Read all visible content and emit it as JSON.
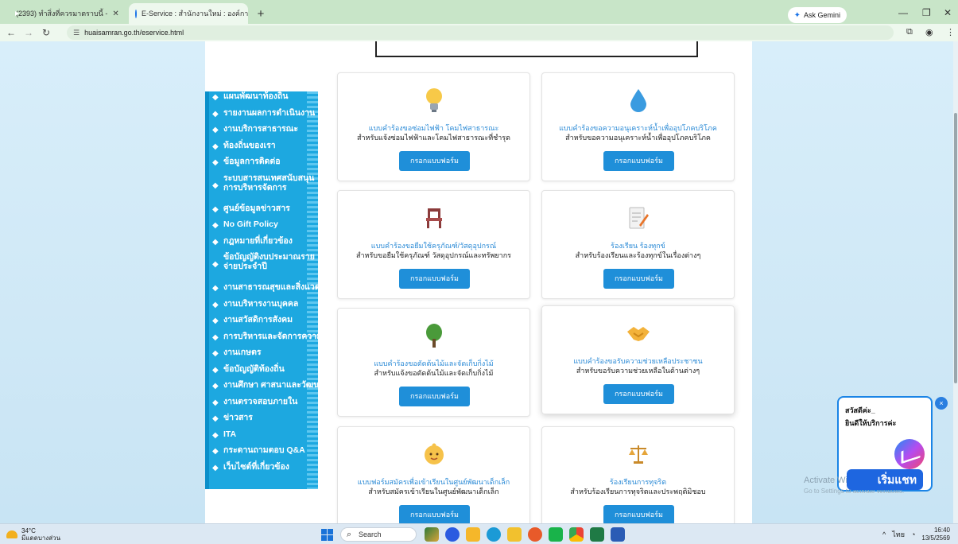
{
  "browser": {
    "tabs": [
      {
        "title": "(2393) ทำสิ่งที่ควรมาตราบนี้ - ",
        "icon": "youtube-icon",
        "active": false
      },
      {
        "title": "E-Service : สำนักงานใหม่ : องค์การ",
        "icon": "globe-icon",
        "active": true
      }
    ],
    "new_tab": "+",
    "gemini": "Ask Gemini",
    "url": "huaisamran.go.th/eservice.html",
    "window_controls": {
      "minimize": "—",
      "restore": "❐",
      "close": "✕"
    }
  },
  "sidebar": {
    "items": [
      {
        "label": "แผนพัฒนาท้องถิ่น",
        "two_line": false
      },
      {
        "label": "รายงานผลการดำเนินงาน",
        "two_line": false
      },
      {
        "label": "งานบริการสาธารณะ",
        "two_line": false
      },
      {
        "label": "ท้องถิ่นของเรา",
        "two_line": false
      },
      {
        "label": "ข้อมูลการติดต่อ",
        "two_line": false
      },
      {
        "label": "ระบบสารสนเทศสนับสนุนการบริหารจัดการ",
        "two_line": true
      },
      {
        "label": "ศูนย์ข้อมูลข่าวสาร",
        "two_line": false
      },
      {
        "label": "No Gift Policy",
        "two_line": false
      },
      {
        "label": "กฎหมายที่เกี่ยวข้อง",
        "two_line": false
      },
      {
        "label": "ข้อบัญญัติงบประมาณรายจ่ายประจำปี",
        "two_line": true
      },
      {
        "label": "งานสาธารณสุขและสิ่งแวดล้อม",
        "two_line": false
      },
      {
        "label": "งานบริหารงานบุคคล",
        "two_line": false
      },
      {
        "label": "งานสวัสดิการสังคม",
        "two_line": false
      },
      {
        "label": "การบริหารและจัดการความเสี่ยง",
        "two_line": false
      },
      {
        "label": "งานเกษตร",
        "two_line": false
      },
      {
        "label": "ข้อบัญญัติท้องถิ่น",
        "two_line": false
      },
      {
        "label": "งานศึกษา ศาสนาและวัฒนธรรม",
        "two_line": false
      },
      {
        "label": "งานตรวจสอบภายใน",
        "two_line": false
      },
      {
        "label": "ข่าวสาร",
        "two_line": false
      },
      {
        "label": "ITA",
        "two_line": false
      },
      {
        "label": "กระดานถามตอบ Q&A",
        "two_line": false
      },
      {
        "label": "เว็บไซต์ที่เกี่ยวข้อง",
        "two_line": false
      }
    ]
  },
  "cards": [
    {
      "icon": "lightbulb-icon",
      "title": "แบบคำร้องขอซ่อมไฟฟ้า โคมไฟสาธารณะ",
      "desc": "สำหรับแจ้งซ่อมไฟฟ้าและโคมไฟสาธารณะที่ชำรุด",
      "button": "กรอกแบบฟอร์ม"
    },
    {
      "icon": "water-drop-icon",
      "title": "แบบคำร้องขอความอนุเคราะห์น้ำเพื่ออุปโภคบริโภค",
      "desc": "สำหรับขอความอนุเคราะห์น้ำเพื่ออุปโภคบริโภค",
      "button": "กรอกแบบฟอร์ม"
    },
    {
      "icon": "chair-icon",
      "title": "แบบคำร้องขอยืมใช้ครุภัณฑ์/วัสดุอุปกรณ์",
      "desc": "สำหรับขอยืมใช้ครุภัณฑ์ วัสดุอุปกรณ์และทรัพยากร",
      "button": "กรอกแบบฟอร์ม"
    },
    {
      "icon": "memo-icon",
      "title": "ร้องเรียน ร้องทุกข์",
      "desc": "สำหรับร้องเรียนและร้องทุกข์ในเรื่องต่างๆ",
      "button": "กรอกแบบฟอร์ม"
    },
    {
      "icon": "tree-icon",
      "title": "แบบคำร้องขอตัดต้นไม้และจัดเก็บกิ่งไม้",
      "desc": "สำหรับแจ้งขอตัดต้นไม้และจัดเก็บกิ่งไม้",
      "button": "กรอกแบบฟอร์ม"
    },
    {
      "icon": "handshake-icon",
      "title": "แบบคำร้องขอรับความช่วยเหลือประชาชน",
      "desc": "สำหรับขอรับความช่วยเหลือในด้านต่างๆ",
      "button": "กรอกแบบฟอร์ม"
    },
    {
      "icon": "baby-icon",
      "title": "แบบฟอร์มสมัครเพื่อเข้าเรียนในศูนย์พัฒนาเด็กเล็ก",
      "desc": "สำหรับสมัครเข้าเรียนในศูนย์พัฒนาเด็กเล็ก",
      "button": "กรอกแบบฟอร์ม"
    },
    {
      "icon": "scales-icon",
      "title": "ร้องเรียนการทุจริต",
      "desc": "สำหรับร้องเรียนการทุจริตและประพฤติมิชอบ",
      "button": "กรอกแบบฟอร์ม"
    }
  ],
  "chat": {
    "greeting": "สวัสดีค่ะ_",
    "welcome": "ยินดีให้บริการค่ะ",
    "start": "เริ่มแชท",
    "close": "×"
  },
  "watermark": {
    "line1": "Activate Windows",
    "line2": "Go to Settings to activate Windows."
  },
  "taskbar": {
    "weather_temp": "34°C",
    "weather_desc": "มีแดดบางส่วน",
    "search": "Search",
    "lang": "ไทย",
    "time": "16:40",
    "date": "13/5/2569"
  },
  "colors": {
    "accent": "#1f8fd9",
    "menu": "#1da8e0",
    "card_title": "#2a8ad6"
  }
}
